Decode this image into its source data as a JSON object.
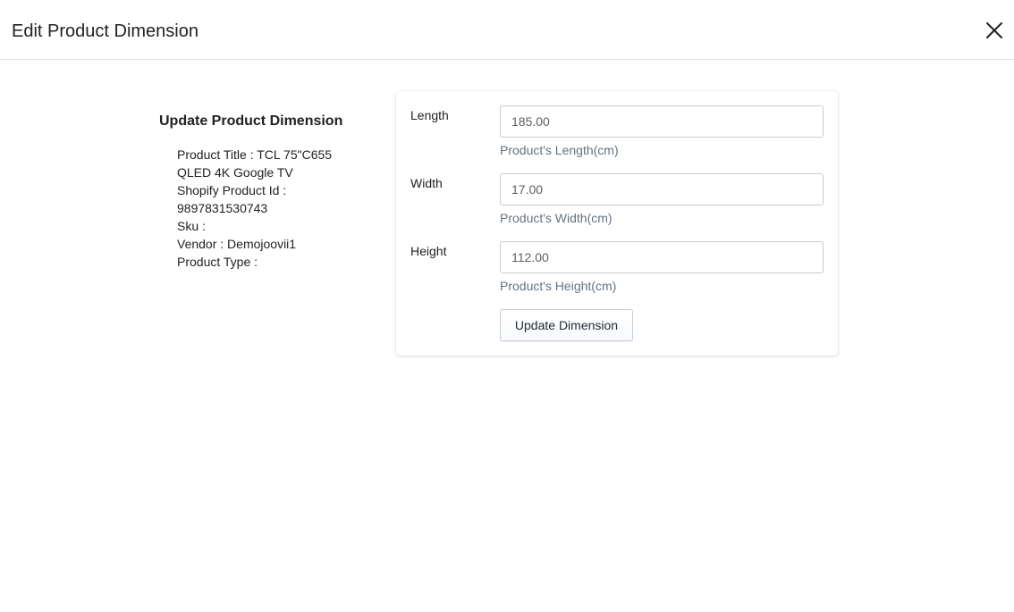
{
  "modal": {
    "title": "Edit Product Dimension",
    "close_icon": "close-icon"
  },
  "product_info": {
    "heading": "Update Product Dimension",
    "lines": [
      "Product Title : TCL 75\"C655 QLED 4K Google TV",
      "Shopify Product Id : 9897831530743",
      "Sku :",
      "Vendor : Demojoovii1",
      "Product Type :"
    ]
  },
  "form": {
    "length": {
      "label": "Length",
      "value": "185.00",
      "help": "Product's Length(cm)"
    },
    "width": {
      "label": "Width",
      "value": "17.00",
      "help": "Product's Width(cm)"
    },
    "height": {
      "label": "Height",
      "value": "112.00",
      "help": "Product's Height(cm)"
    },
    "submit_label": "Update Dimension"
  },
  "colors": {
    "text": "#202223",
    "help_text": "#637381",
    "border": "#c4cdd5"
  }
}
